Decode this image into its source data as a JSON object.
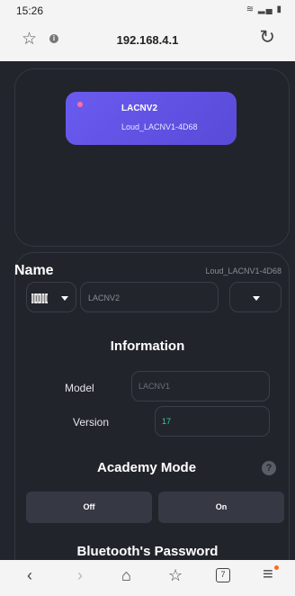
{
  "status_bar": {
    "time": "15:26",
    "icons": "wifi signal battery"
  },
  "browser": {
    "url": "192.168.4.1",
    "star_icon": "star-icon",
    "info_icon": "info-icon",
    "reload_icon": "reload-icon"
  },
  "device": {
    "name": "LACNV2",
    "id": "Loud_LACNV1-4D68"
  },
  "name_section": {
    "heading": "Name",
    "device_id": "Loud_LACNV1-4D68",
    "input_value": "LACNV2"
  },
  "information": {
    "title": "Information",
    "model_label": "Model",
    "model_value": "LACNV1",
    "version_label": "Version",
    "version_value": "17"
  },
  "academy_mode": {
    "title": "Academy Mode",
    "help": "?",
    "off_label": "Off",
    "on_label": "On"
  },
  "bluetooth": {
    "title": "Bluetooth's Password"
  },
  "nav": {
    "back": "‹",
    "forward": "›",
    "home": "⌂",
    "fav": "☆",
    "tabs": "7",
    "menu": "≡"
  },
  "colors": {
    "background": "#23252d",
    "card_gradient_start": "#6a5bf0",
    "card_gradient_end": "#5a4ad8",
    "version_text": "#2fcfa0",
    "accent_dot": "#ff6fa0"
  }
}
